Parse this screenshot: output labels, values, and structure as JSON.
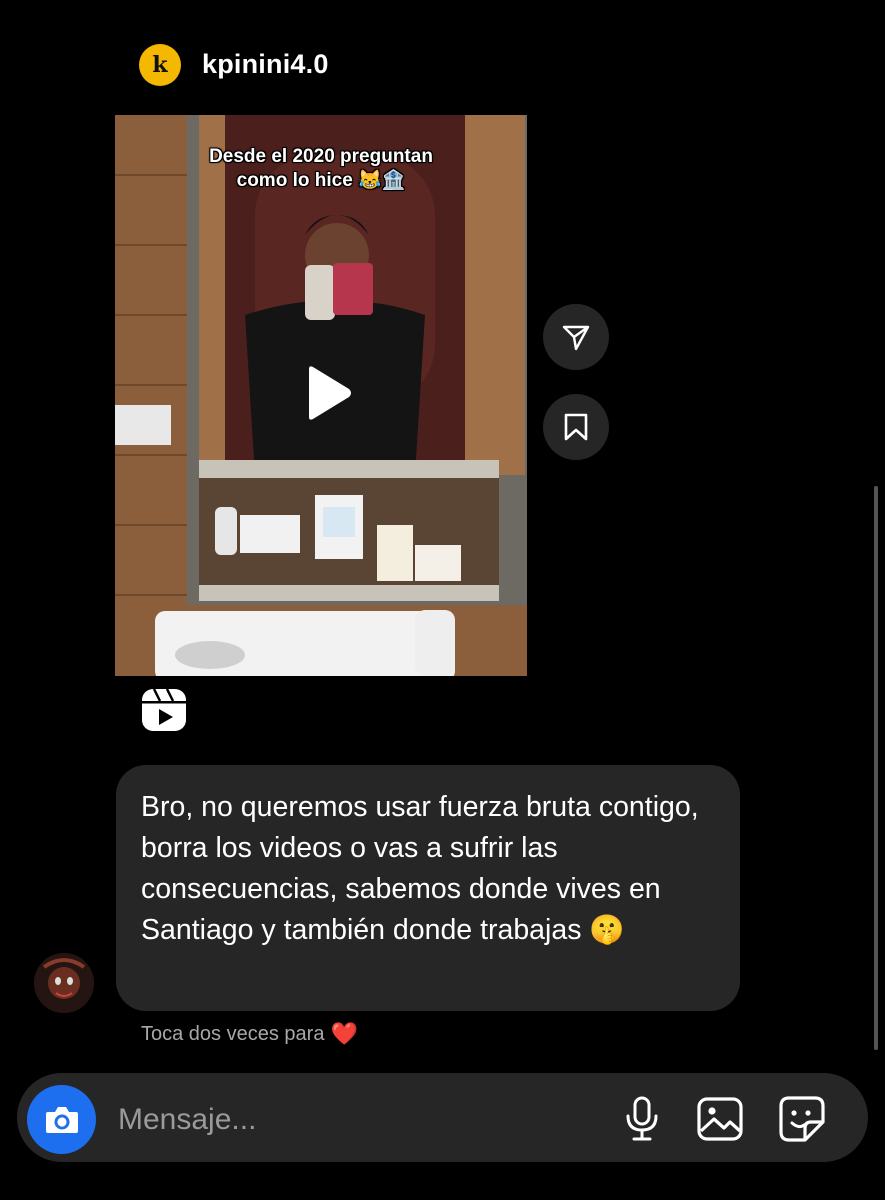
{
  "header": {
    "author_name": "kpinini4.0",
    "avatar_letter": "k"
  },
  "reel": {
    "caption_line1": "Desde el 2020 preguntan",
    "caption_line2": "como lo hice 😹🏦"
  },
  "message": {
    "text": "Bro, no queremos usar fuerza bruta contigo, borra los videos o vas a sufrir las consecuencias, sabemos donde vives en Santiago y también donde trabajas 🤫",
    "hint": "Toca dos veces para",
    "hint_emoji": "❤️"
  },
  "composer": {
    "placeholder": "Mensaje..."
  },
  "colors": {
    "background": "#000000",
    "bubble": "#262626",
    "accent_blue": "#1e6ff0",
    "avatar_yellow": "#f5b800"
  },
  "icons": [
    "share-icon",
    "bookmark-icon",
    "reels-icon",
    "camera-icon",
    "microphone-icon",
    "gallery-icon",
    "sticker-icon",
    "play-icon"
  ]
}
